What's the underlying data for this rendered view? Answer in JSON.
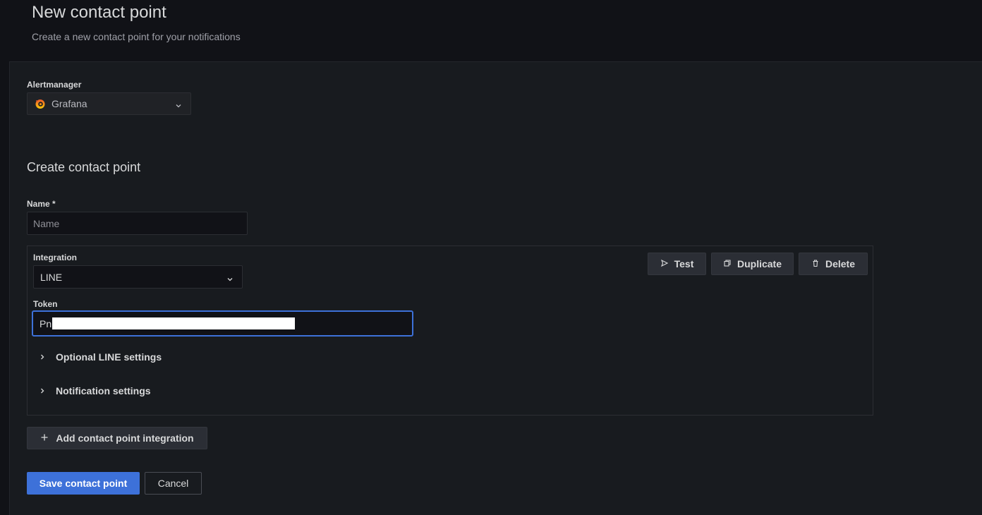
{
  "header": {
    "title": "New contact point",
    "subtitle": "Create a new contact point for your notifications"
  },
  "alertmanager": {
    "label": "Alertmanager",
    "selected": "Grafana",
    "icon": "grafana-logo-icon"
  },
  "form": {
    "section_title": "Create contact point",
    "name_label": "Name *",
    "name_placeholder": "Name",
    "name_value": ""
  },
  "integration": {
    "label": "Integration",
    "selected": "LINE",
    "token_label": "Token",
    "token_value_visible": "Pn",
    "buttons": {
      "test": "Test",
      "duplicate": "Duplicate",
      "delete": "Delete"
    },
    "sections": [
      {
        "label": "Optional LINE settings"
      },
      {
        "label": "Notification settings"
      }
    ]
  },
  "actions": {
    "add_integration": "Add contact point integration",
    "save": "Save contact point",
    "cancel": "Cancel"
  },
  "colors": {
    "primary": "#3d71d9",
    "background": "#181b1f",
    "header_bg": "#111217"
  }
}
